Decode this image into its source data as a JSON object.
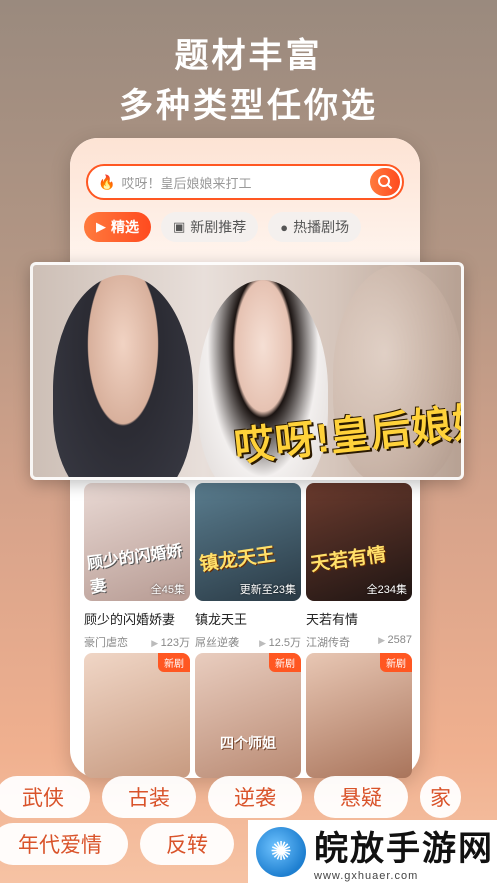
{
  "headline": {
    "line1": "题材丰富",
    "line2": "多种类型任你选"
  },
  "search": {
    "placeholder": "哎呀！皇后娘娘来打工"
  },
  "tabs": [
    {
      "label": "精选",
      "active": true,
      "icon": "video-icon"
    },
    {
      "label": "新剧推荐",
      "active": false,
      "icon": "new-icon"
    },
    {
      "label": "热播剧场",
      "active": false,
      "icon": "play-icon"
    }
  ],
  "banner": {
    "title": "哎呀!皇后娘娘来打工"
  },
  "cards": [
    {
      "poster_text": "顾少的闪婚娇妻",
      "episodes": "全45集",
      "title": "顾少的闪婚娇妻",
      "tag": "豪门虐恋",
      "views": "123万",
      "badge": ""
    },
    {
      "poster_text": "镇龙天王",
      "episodes": "更新至23集",
      "title": "镇龙天王",
      "tag": "屌丝逆袭",
      "views": "12.5万",
      "badge": ""
    },
    {
      "poster_text": "天若有情",
      "episodes": "全234集",
      "title": "天若有情",
      "tag": "江湖传奇",
      "views": "2587",
      "badge": ""
    },
    {
      "poster_text": "",
      "episodes": "",
      "title": "",
      "tag": "",
      "views": "",
      "badge": "新剧"
    },
    {
      "poster_text": "四个师姐",
      "episodes": "",
      "title": "",
      "tag": "",
      "views": "",
      "badge": "新剧"
    },
    {
      "poster_text": "",
      "episodes": "",
      "title": "",
      "tag": "",
      "views": "",
      "badge": "新剧"
    }
  ],
  "genres_row1": [
    "武侠",
    "古装",
    "逆袭",
    "悬疑",
    "家"
  ],
  "genres_row2": [
    "年代爱情",
    "反转"
  ],
  "watermark": {
    "name": "皖放手游网",
    "url": "www.gxhuaer.com"
  },
  "colors": {
    "accent": "#ff5722",
    "genre_text": "#d9532a"
  }
}
